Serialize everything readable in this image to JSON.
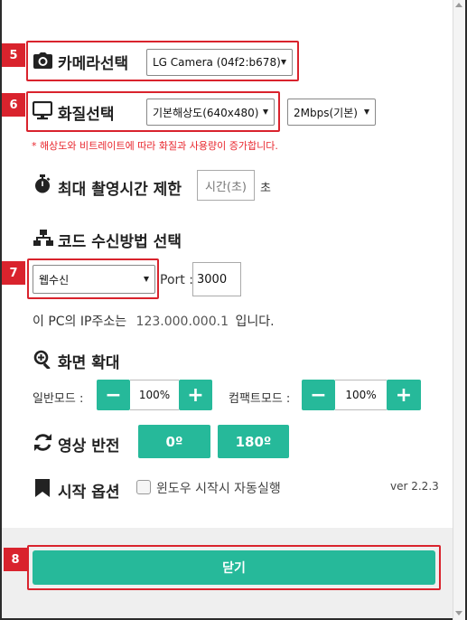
{
  "colors": {
    "accent": "#26b99a",
    "annotation": "#d9232d",
    "warning": "#e8262d"
  },
  "badges": [
    "5",
    "6",
    "7",
    "8"
  ],
  "camera": {
    "label": "카메라선택",
    "icon": "camera-icon",
    "selected": "LG Camera (04f2:b678)"
  },
  "quality": {
    "label": "화질선택",
    "icon": "monitor-icon",
    "resolution": "기본해상도(640x480)",
    "bitrate": "2Mbps(기본)"
  },
  "warning": "* 해상도와 비트레이트에 따라 화질과 사용량이 증가합니다.",
  "max_time": {
    "label": "최대 촬영시간 제한",
    "icon": "stopwatch-icon",
    "placeholder": "시간(초)",
    "unit": "초"
  },
  "code": {
    "label": "코드 수신방법 선택",
    "icon": "sitemap-icon",
    "method": "웹수신",
    "port_label": "Port :",
    "port": "3000"
  },
  "ip": {
    "prefix": "이 PC의 IP주소는",
    "address": "123.000.000.1",
    "suffix": "입니다."
  },
  "zoom": {
    "label": "화면 확대",
    "icon": "zoom-in-icon",
    "normal_label": "일반모드 :",
    "normal_value": "100%",
    "compact_label": "컴팩트모드 :",
    "compact_value": "100%",
    "minus": "−",
    "plus": "+"
  },
  "flip": {
    "label": "영상 반전",
    "icon": "refresh-icon",
    "options": [
      "0º",
      "180º"
    ]
  },
  "start": {
    "label": "시작 옵션",
    "icon": "bookmark-icon",
    "checkbox_label": "윈도우 시작시 자동실행",
    "checked": false,
    "version": "ver 2.2.3"
  },
  "close_label": "닫기"
}
